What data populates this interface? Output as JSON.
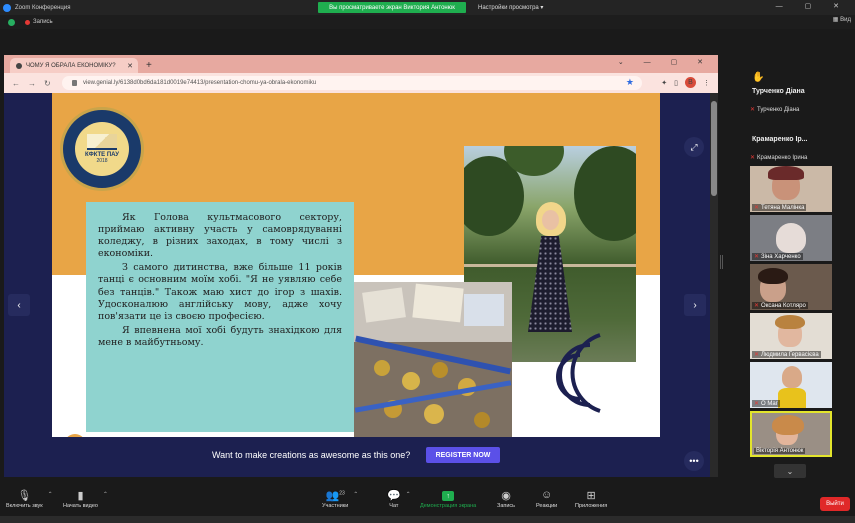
{
  "zoom": {
    "title": "Zoom Конференция",
    "share_banner": "Вы просматриваете экран Виктория Антонюк",
    "view_options": "Настройки просмотра",
    "recording": "Запись",
    "view_label": "Вид",
    "window_controls": "—  ▢  ✕"
  },
  "browser": {
    "tab_title": "ЧОМУ Я ОБРАЛА ЕКОНОМІКУ?",
    "url": "view.genial.ly/6138d0bd6da181d0019e74413/presentation-chomu-ya-obrala-ekonomiku",
    "profile_initial": "В"
  },
  "slide": {
    "logo_line1": "КФКТЕ ПАУ",
    "logo_line2": "2018",
    "paragraphs": [
      "Як Голова культмасового сектору, приймаю активну участь у самоврядуванні коледжу, в різних заходах, в тому числі з економіки.",
      "З самого дитинства, вже більше 11 років танці є основним моїм хобі. \"Я не уявляю себе без танців.\" Також маю хист до ігор з шахів. Удосконалюю англійську мову, адже хочу пов'язати це із своєю професією.",
      "Я впевнена мої хобі будуть знахідкою для мене в майбутньому."
    ],
    "genially_brand": "genially",
    "cta_text": "Want to make creations as awesome as this one?",
    "cta_button": "REGISTER NOW"
  },
  "participants": [
    {
      "big_name": "Турченко Діана",
      "small_name": "Турченко Діана",
      "type": "name",
      "hand": true
    },
    {
      "big_name": "Крамаренко Ір...",
      "small_name": "Крамаренко Ірина",
      "type": "name",
      "hand": false
    },
    {
      "label": "Тетяна Малінка",
      "type": "video",
      "bg": "#cbb9a7",
      "skin": "#c99279"
    },
    {
      "label": "Зіна Харченко",
      "type": "video",
      "bg": "#7c7e84",
      "skin": "#d7c8c0"
    },
    {
      "label": "Оксана Котляро",
      "type": "video",
      "bg": "#6b5a4d",
      "skin": "#caa08a"
    },
    {
      "label": "Людмила Гервасієва",
      "type": "video",
      "bg": "#e3ddd4",
      "skin": "#e1b79f"
    },
    {
      "label": "О Маг",
      "type": "video",
      "bg": "#dfe6ee",
      "skin": "#d9a988"
    },
    {
      "label": "Вікторія Антонюк",
      "type": "video",
      "bg": "#9a8f85",
      "skin": "#e3b59b",
      "active": true
    }
  ],
  "toolbar": {
    "mic": "Включить звук",
    "video": "Начать видео",
    "participants": "Участники",
    "participants_count": "23",
    "chat": "Чат",
    "share": "Демонстрация экрана",
    "record": "Запись",
    "reactions": "Реакции",
    "apps": "Приложения",
    "leave": "Выйти"
  }
}
